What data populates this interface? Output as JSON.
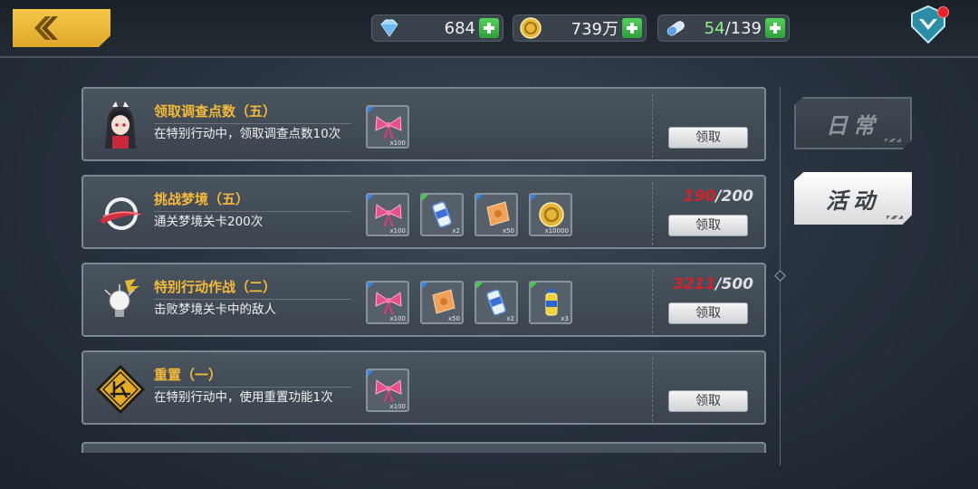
{
  "currency": {
    "diamonds": "684",
    "coins": "739万",
    "stamina_current": "54",
    "stamina_separator": "/",
    "stamina_max": "139"
  },
  "tabs": [
    {
      "label": "日常",
      "active": false
    },
    {
      "label": "活动",
      "active": true
    }
  ],
  "claim_label": "领取",
  "tasks": [
    {
      "title": "领取调查点数（五）",
      "desc": "在特别行动中，领取调查点数10次",
      "icon": "anime-girl-avatar-icon",
      "rewards": [
        {
          "icon": "pink-bow-icon",
          "count": "x100"
        }
      ],
      "progress": null
    },
    {
      "title": "挑战梦境（五）",
      "desc": "通关梦境关卡200次",
      "icon": "dream-ring-icon",
      "rewards": [
        {
          "icon": "pink-bow-icon",
          "count": "x100"
        },
        {
          "icon": "acap-can-icon",
          "count": "x2",
          "tag": "AcAp"
        },
        {
          "icon": "orange-ticket-icon",
          "count": "x50"
        },
        {
          "icon": "gold-coin-icon",
          "count": "x10000"
        }
      ],
      "progress": {
        "current": "190",
        "total": "/200"
      }
    },
    {
      "title": "特别行动作战（二）",
      "desc": "击败梦境关卡中的敌人",
      "icon": "lightbulb-icon",
      "rewards": [
        {
          "icon": "pink-bow-icon",
          "count": "x100"
        },
        {
          "icon": "orange-ticket-icon",
          "count": "x50"
        },
        {
          "icon": "acap-can-icon",
          "count": "x2",
          "tag": "AcAp"
        },
        {
          "icon": "exp-bottle-icon",
          "count": "x3",
          "tag": "Exp"
        }
      ],
      "progress": {
        "current": "3211",
        "total": "/500"
      }
    },
    {
      "title": "重置（一）",
      "desc": "在特别行动中，使用重置功能1次",
      "icon": "reset-sign-icon",
      "rewards": [
        {
          "icon": "pink-bow-icon",
          "count": "x100"
        }
      ],
      "progress": null
    }
  ],
  "colors": {
    "title": "#f5b93a",
    "progress_current": "#d52128",
    "accent": "#f5c84a"
  }
}
